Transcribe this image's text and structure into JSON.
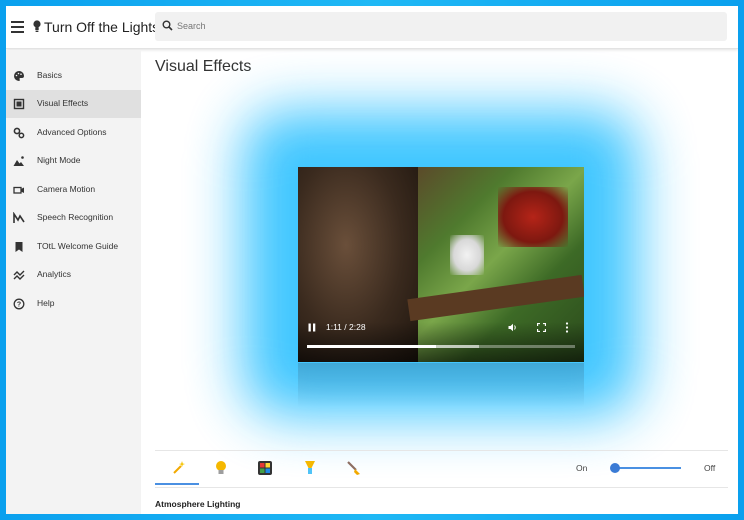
{
  "header": {
    "app_title": "Turn Off the Lights™",
    "search_placeholder": "Search"
  },
  "sidebar": {
    "active_index": 1,
    "items": [
      {
        "label": "Basics",
        "icon": "palette-icon"
      },
      {
        "label": "Visual Effects",
        "icon": "picture-frame-icon"
      },
      {
        "label": "Advanced Options",
        "icon": "gears-icon"
      },
      {
        "label": "Night Mode",
        "icon": "moon-mountain-icon"
      },
      {
        "label": "Camera Motion",
        "icon": "camera-icon"
      },
      {
        "label": "Speech Recognition",
        "icon": "voice-wave-icon"
      },
      {
        "label": "TOtL Welcome Guide",
        "icon": "bookmark-icon"
      },
      {
        "label": "Analytics",
        "icon": "trend-chart-icon"
      },
      {
        "label": "Help",
        "icon": "help-circle-icon"
      }
    ]
  },
  "main": {
    "page_title": "Visual Effects",
    "video": {
      "time": "1:11 / 2:28",
      "played_fraction": 0.48,
      "buffered_fraction": 0.64
    },
    "tabs": [
      {
        "icon": "magic-wand-icon",
        "color": "#f2a900"
      },
      {
        "icon": "lightbulb-icon",
        "color": "#f5b800"
      },
      {
        "icon": "color-grid-icon",
        "color": "#e53935"
      },
      {
        "icon": "lamp-icon",
        "color": "#f5b800"
      },
      {
        "icon": "paint-brush-icon",
        "color": "#f2a900"
      }
    ],
    "active_tab": 0,
    "toggle": {
      "on_label": "On",
      "off_label": "Off",
      "value_fraction": 0.0
    },
    "section_title": "Atmosphere Lighting"
  },
  "colors": {
    "accent": "#4a90e2",
    "glow": "#35c3ff",
    "page_background": "#1fb8f5"
  }
}
